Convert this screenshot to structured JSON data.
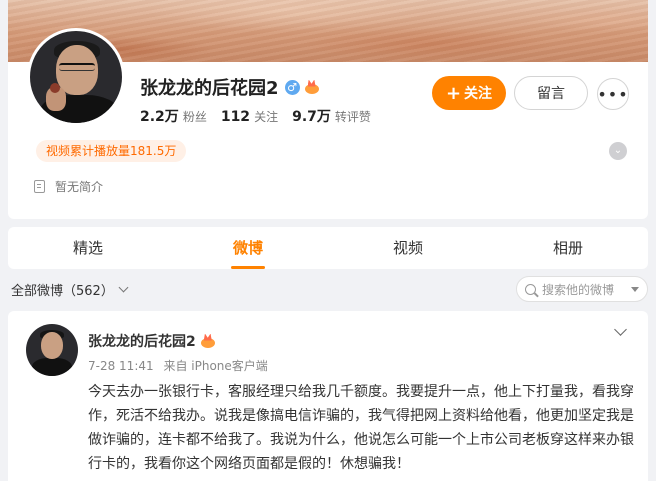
{
  "profile": {
    "username": "张龙龙的后花园2",
    "gender_symbol": "♂",
    "stats": [
      {
        "value": "2.2万",
        "label": "粉丝"
      },
      {
        "value": "112",
        "label": "关注"
      },
      {
        "value": "9.7万",
        "label": "转评赞"
      }
    ],
    "follow_label": "关注",
    "follow_plus": "+",
    "message_label": "留言",
    "more_label": "•••",
    "play_count": "视频累计播放量181.5万",
    "intro": "暂无简介"
  },
  "tabs": [
    {
      "label": "精选"
    },
    {
      "label": "微博"
    },
    {
      "label": "视频"
    },
    {
      "label": "相册"
    }
  ],
  "filter": {
    "label": "全部微博（562）",
    "search_placeholder": "搜索他的微博"
  },
  "post": {
    "author": "张龙龙的后花园2",
    "time": "7-28 11:41",
    "source": "来自 iPhone客户端",
    "text": "今天去办一张银行卡，客服经理只给我几千额度。我要提升一点，他上下打量我，看我穿作，死活不给我办。说我是像搞电信诈骗的，我气得把网上资料给他看，他更加坚定我是做诈骗的，连卡都不给我了。我说为什么，他说怎么可能一个上市公司老板穿这样来办银行卡的，我看你这个网络页面都是假的！休想骗我！"
  },
  "colors": {
    "accent": "#ff8200",
    "page_bg": "#f1f2f5",
    "badge_bg": "#fff0e6",
    "badge_text": "#ff6a00",
    "gender_blue": "#5fa9f0"
  },
  "icons": [
    "gender-male-icon",
    "crown-badge-icon",
    "more-dots-icon",
    "expand-chevron-icon",
    "doc-icon",
    "chevron-down-icon",
    "search-icon",
    "caret-down-icon"
  ]
}
